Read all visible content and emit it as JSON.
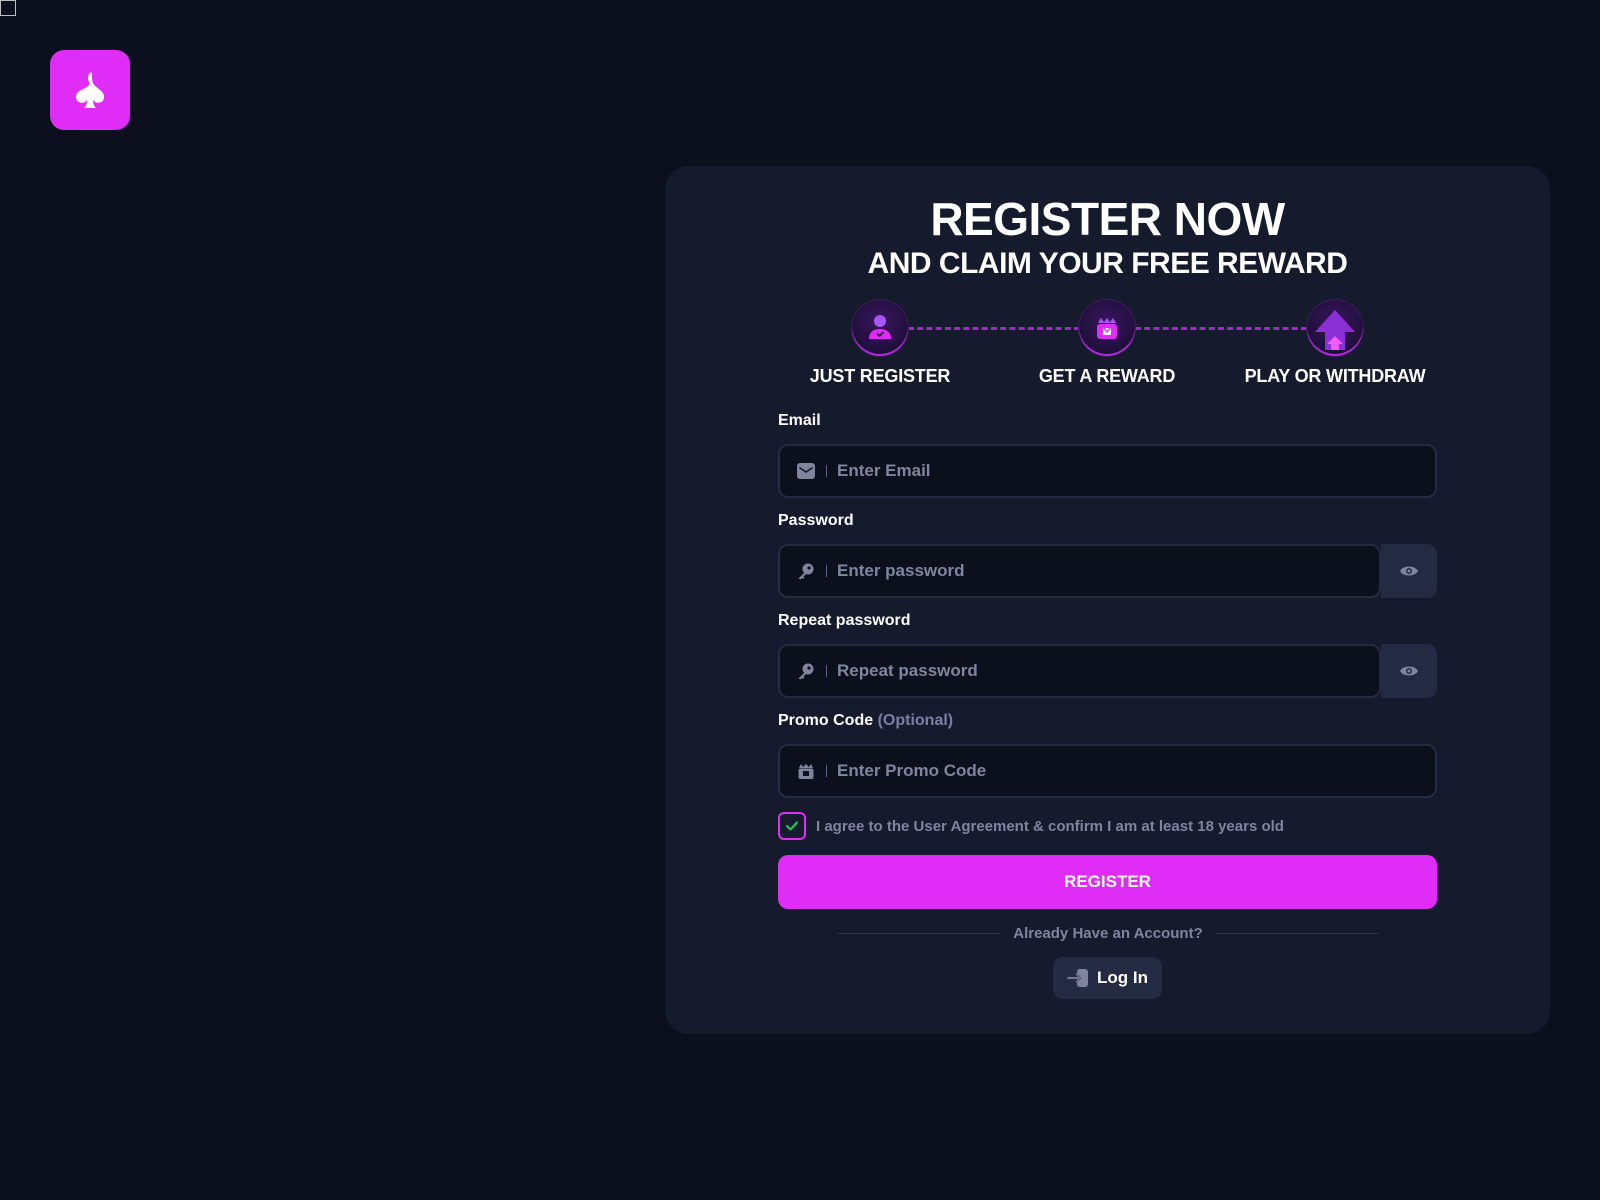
{
  "brand": {
    "logo_icon": "spade-flame-icon",
    "accent_color": "#e02cf7"
  },
  "hero": {
    "title": "REGISTER NOW",
    "subtitle": "AND CLAIM YOUR FREE REWARD"
  },
  "steps": [
    {
      "label": "JUST REGISTER",
      "icon": "user-check-icon"
    },
    {
      "label": "GET A REWARD",
      "icon": "gift-icon"
    },
    {
      "label": "PLAY OR WITHDRAW",
      "icon": "arrow-up-icon"
    }
  ],
  "form": {
    "email": {
      "label": "Email",
      "placeholder": "Enter Email",
      "value": "",
      "icon": "mail-icon"
    },
    "password": {
      "label": "Password",
      "placeholder": "Enter password",
      "value": "",
      "icon": "key-icon"
    },
    "repeat_password": {
      "label": "Repeat password",
      "placeholder": "Repeat password",
      "value": "",
      "icon": "key-icon"
    },
    "promo": {
      "label": "Promo Code",
      "optional_label": "(Optional)",
      "placeholder": "Enter Promo Code",
      "value": "",
      "icon": "gift-icon"
    },
    "agree": {
      "text": "I agree to the User Agreement & confirm I am at least 18 years old",
      "checked": true
    },
    "register_label": "REGISTER"
  },
  "login": {
    "prompt": "Already Have an Account?",
    "button_label": "Log In"
  }
}
